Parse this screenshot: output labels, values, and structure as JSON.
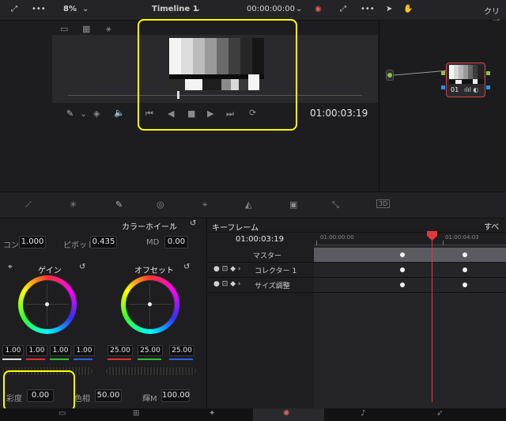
{
  "topbar": {
    "zoom": "8%",
    "timeline_name": "Timeline 1",
    "timecode": "00:00:00:00",
    "clip_label": "クリップ"
  },
  "viewer": {
    "timecode": "01:00:03:19"
  },
  "node": {
    "label": "01"
  },
  "color_panel": {
    "title": "カラーホイール",
    "contrast_label": "コン",
    "contrast_value": "1.000",
    "pivot_label": "ピボット",
    "pivot_value": "0.435",
    "md_label": "MD",
    "md_value": "0.00",
    "gain_label": "ゲイン",
    "offset_label": "オフセット",
    "gain_values": [
      "1.00",
      "1.00",
      "1.00",
      "1.00"
    ],
    "offset_values": [
      "25.00",
      "25.00",
      "25.00"
    ],
    "saturation_label": "彩度",
    "saturation_value": "0.00",
    "hue_label": "色相",
    "hue_value": "50.00",
    "lum_mix_label": "輝M",
    "lum_mix_value": "100.00"
  },
  "keyframe_panel": {
    "title": "キーフレーム",
    "filter": "すべて",
    "timecode": "01:00:03:19",
    "ruler_start": "01:00:00:00",
    "ruler_end": "01:00:04:03",
    "rows": [
      "マスター",
      "コレクター 1",
      "サイズ調整"
    ]
  },
  "colors": {
    "highlight": "#ffff00",
    "playhead": "#e03a3a",
    "node_border": "#d94040"
  }
}
